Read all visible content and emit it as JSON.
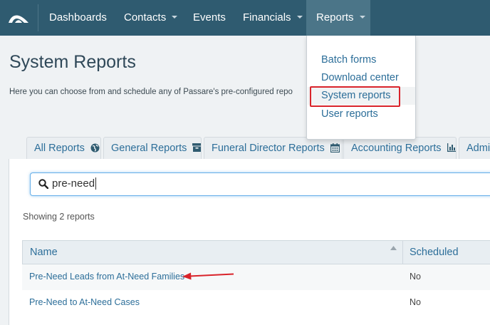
{
  "nav": {
    "items": [
      {
        "label": "Dashboards"
      },
      {
        "label": "Contacts"
      },
      {
        "label": "Events"
      },
      {
        "label": "Financials"
      },
      {
        "label": "Reports"
      }
    ],
    "logo_icon": "passare-logo-icon"
  },
  "reports_menu": {
    "items": [
      {
        "label": "Batch forms"
      },
      {
        "label": "Download center"
      },
      {
        "label": "System reports"
      },
      {
        "label": "User reports"
      }
    ],
    "highlight_color": "#d9242b"
  },
  "page": {
    "title": "System Reports",
    "description": "Here you can choose from and schedule any of Passare's pre-configured repo"
  },
  "tabs": [
    {
      "label": "All Reports",
      "icon": "globe-icon"
    },
    {
      "label": "General Reports",
      "icon": "archive-icon"
    },
    {
      "label": "Funeral Director Reports",
      "icon": "calendar-icon"
    },
    {
      "label": "Accounting Reports",
      "icon": "bar-chart-icon"
    },
    {
      "label": "Admi"
    }
  ],
  "search": {
    "value": "pre-need"
  },
  "results": {
    "count_text": "Showing 2 reports",
    "columns": {
      "name": "Name",
      "scheduled": "Scheduled"
    },
    "rows": [
      {
        "name": "Pre-Need Leads from At-Need Families",
        "scheduled": "No"
      },
      {
        "name": "Pre-Need to At-Need Cases",
        "scheduled": "No"
      }
    ]
  },
  "colors": {
    "nav_bg": "#2f5b70",
    "link": "#2c6e99",
    "annotation": "#d9242b"
  }
}
